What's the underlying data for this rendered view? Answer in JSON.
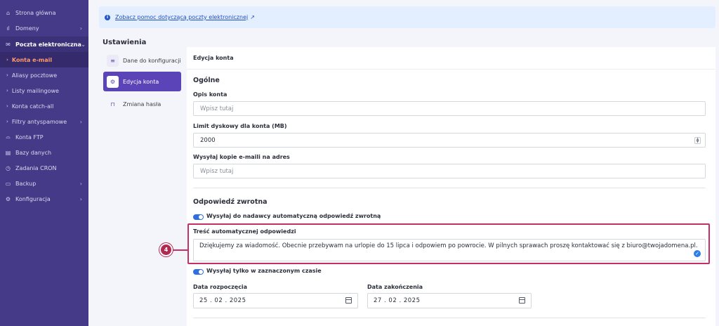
{
  "sidebar": {
    "items": [
      {
        "label": "Strona główna",
        "icon": "home-icon"
      },
      {
        "label": "Domeny",
        "icon": "chart-icon"
      },
      {
        "label": "Poczta elektroniczna",
        "icon": "mail-icon"
      },
      {
        "label": "Konta e-mail"
      },
      {
        "label": "Aliasy pocztowe"
      },
      {
        "label": "Listy mailingowe"
      },
      {
        "label": "Konta catch-all"
      },
      {
        "label": "Filtry antyspamowe"
      },
      {
        "label": "Konta FTP",
        "icon": "folder-icon"
      },
      {
        "label": "Bazy danych",
        "icon": "database-icon"
      },
      {
        "label": "Zadania CRON",
        "icon": "clock-icon"
      },
      {
        "label": "Backup",
        "icon": "inbox-icon"
      },
      {
        "label": "Konfiguracja",
        "icon": "gear-icon"
      }
    ]
  },
  "info_link": "Zobacz pomoc dotyczącą poczty elektronicznej",
  "settings": {
    "title": "Ustawienia",
    "nav": [
      {
        "label": "Dane do konfiguracji",
        "icon": "list-icon"
      },
      {
        "label": "Edycja konta",
        "icon": "gear-icon"
      },
      {
        "label": "Zmiana hasła",
        "icon": "lock-icon"
      }
    ]
  },
  "form": {
    "header": "Edycja konta",
    "general_title": "Ogólne",
    "desc_label": "Opis konta",
    "desc_placeholder": "Wpisz tutaj",
    "limit_label": "Limit dyskowy dla konta (MB)",
    "limit_value": "2000",
    "copy_label": "Wysyłaj kopie e-maili na adres",
    "copy_placeholder": "Wpisz tutaj",
    "reply_title": "Odpowiedź zwrotna",
    "toggle_reply": {
      "label": "Wysyłaj do nadawcy automatyczną odpowiedź zwrotną",
      "on": true
    },
    "reply_content_label": "Treść automatycznej odpowiedzi",
    "reply_content": "Dziękujemy za wiadomość. Obecnie przebywam na urlopie do 15 lipca i odpowiem po powrocie. W pilnych sprawach proszę kontaktować się z biuro@twojadomena.pl.",
    "toggle_time": {
      "label": "Wysyłaj tylko w zaznaczonym czasie",
      "on": true
    },
    "start_label": "Data rozpoczęcia",
    "start_value": "25 . 02 . 2025",
    "end_label": "Data zakończenia",
    "end_value": "27 . 02 . 2025"
  },
  "step_marker": "4",
  "colors": {
    "sidebar": "#453a87",
    "accent": "#5b44b8",
    "highlight": "#c42f66",
    "toggle": "#2f6fe0",
    "active_sub": "#ff9a6e"
  }
}
